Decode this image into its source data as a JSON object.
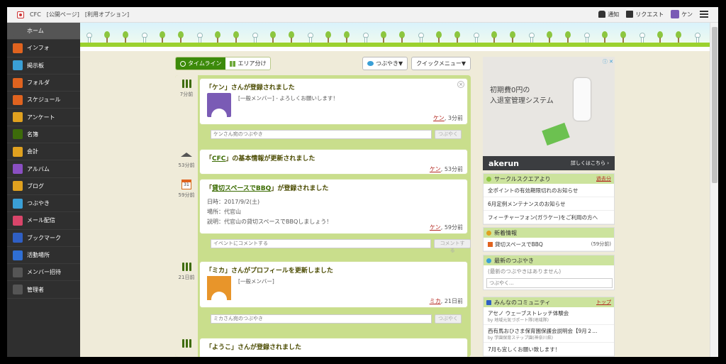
{
  "topbar": {
    "site": "CFC",
    "links": [
      "[公開ページ]",
      "[利用オプション]"
    ],
    "notify": "通知",
    "request": "リクエスト",
    "user": "ケン"
  },
  "sidebar": {
    "items": [
      {
        "label": "ホーム",
        "icon": "home-icon",
        "color": "#555555"
      },
      {
        "label": "インフォ",
        "icon": "info-icon",
        "color": "#e0631f"
      },
      {
        "label": "掲示板",
        "icon": "board-icon",
        "color": "#3a9fd6"
      },
      {
        "label": "フォルダ",
        "icon": "folder-icon",
        "color": "#e0631f"
      },
      {
        "label": "スケジュール",
        "icon": "calendar-icon",
        "color": "#e0631f"
      },
      {
        "label": "アンケート",
        "icon": "survey-icon",
        "color": "#e0a11f"
      },
      {
        "label": "名簿",
        "icon": "members-icon",
        "color": "#3d6b0a"
      },
      {
        "label": "会計",
        "icon": "accounting-icon",
        "color": "#e0a11f"
      },
      {
        "label": "アルバム",
        "icon": "album-icon",
        "color": "#8a4fc2"
      },
      {
        "label": "ブログ",
        "icon": "blog-icon",
        "color": "#e0a11f"
      },
      {
        "label": "つぶやき",
        "icon": "tweet-icon",
        "color": "#3a9fd6"
      },
      {
        "label": "メール配信",
        "icon": "mail-icon",
        "color": "#d9456a"
      },
      {
        "label": "ブックマーク",
        "icon": "bookmark-icon",
        "color": "#2f5fc4"
      },
      {
        "label": "活動場所",
        "icon": "location-icon",
        "color": "#2f6fd4"
      },
      {
        "label": "メンバー招待",
        "icon": "invite-icon",
        "color": "#555555"
      },
      {
        "label": "管理者",
        "icon": "admin-icon",
        "color": "#555555"
      }
    ]
  },
  "timeline": {
    "tab_timeline": "タイムライン",
    "tab_area": "エリア分け",
    "tweet_btn": "つぶやき▼",
    "quick_menu": "クイックメニュー▼",
    "entries": [
      {
        "time": "7分前",
        "title": "「ケン」さんが登録されました",
        "text": "[一般メンバー] - よろしくお願いします！",
        "author": "ケン",
        "ago": "3分前",
        "comment_placeholder": "ケンさん宛のつぶやき",
        "comment_btn": "つぶやく"
      },
      {
        "time": "53分前",
        "title_prefix": "「",
        "title_link": "CFC",
        "title_suffix": "」の基本情報が更新されました",
        "author": "ケン",
        "ago": "53分前"
      },
      {
        "time": "59分前",
        "title_prefix": "「",
        "title_link": "貸切スペースでBBQ",
        "title_suffix": "」が登録されました",
        "date": "日時：2017/9/2(土)",
        "place": "場所：代官山",
        "desc": "説明：代官山の貸切スペースでBBQしましょう！",
        "author": "ケン",
        "ago": "59分前",
        "comment_placeholder": "イベントにコメントする",
        "comment_btn": "コメントする",
        "cal_num": "31"
      },
      {
        "time": "21日前",
        "title": "「ミカ」さんがプロフィールを更新しました",
        "text": "[一般メンバー]",
        "author": "ミカ",
        "ago": "21日前",
        "comment_placeholder": "ミカさん宛のつぶやき",
        "comment_btn": "つぶやく"
      },
      {
        "title": "「ようこ」さんが登録されました"
      }
    ]
  },
  "ad": {
    "line1": "初期費0円の",
    "line2": "入退室管理システム",
    "brand": "akerun",
    "cta": "詳しくはこちら ›"
  },
  "circle": {
    "header": "サークルスクエアより",
    "more": "過去分",
    "items": [
      "全ポイントの有効期限切れのお知らせ",
      "6月定例メンテナンスのお知らせ",
      "フィーチャーフォン(ガラケー)をご利用の方へ"
    ]
  },
  "newinfo": {
    "header": "新着情報",
    "item": "貸切スペースでBBQ",
    "ago": "(59分前)"
  },
  "tweets": {
    "header": "最新のつぶやき",
    "empty": "(最新のつぶやきはありません)",
    "placeholder": "つぶやく..."
  },
  "community": {
    "header": "みんなのコミュニティ",
    "top": "トップ",
    "items": [
      {
        "title": "アセノ ウェーブストレッチ体験会",
        "sub": "by 地域元気づポート隊(地域隊)"
      },
      {
        "title": "西有馬おひさま保育園保護会説明会【9月２...",
        "sub": "by 学園保育ステップ園(神奈川県)"
      },
      {
        "title": "7月も宜しくお願い致します！",
        "sub": ""
      }
    ]
  }
}
